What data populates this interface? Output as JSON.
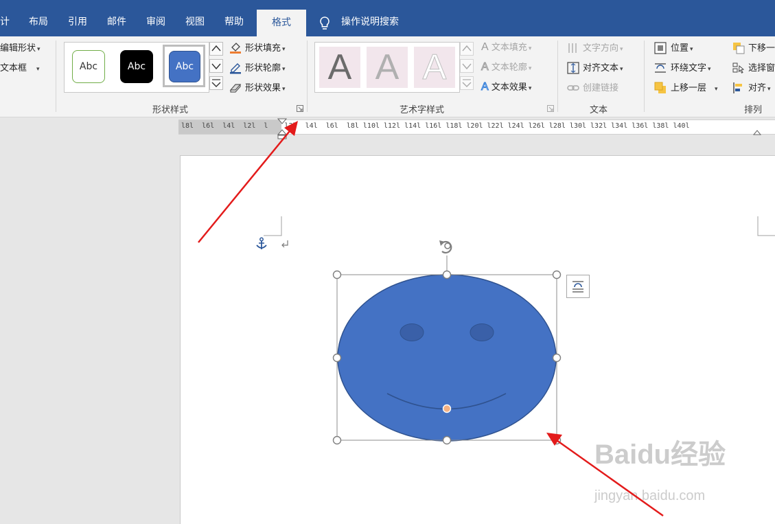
{
  "tabs": {
    "design_partial": "计",
    "layout": "布局",
    "references": "引用",
    "mailings": "邮件",
    "review": "审阅",
    "view": "视图",
    "help": "帮助",
    "format": "格式",
    "tell_me": "操作说明搜索"
  },
  "insert_shapes": {
    "edit_shape": "编辑形状",
    "text_box": "文本框"
  },
  "shape_styles": {
    "swatch_1": "Abc",
    "swatch_2": "Abc",
    "swatch_3": "Abc",
    "fill": "形状填充",
    "outline": "形状轮廓",
    "effects": "形状效果",
    "group_label": "形状样式"
  },
  "wordart": {
    "letter": "A",
    "text_fill": "文本填充",
    "text_outline": "文本轮廓",
    "text_effects": "文本效果",
    "group_label": "艺术字样式"
  },
  "text_group": {
    "direction": "文字方向",
    "align_text": "对齐文本",
    "create_link": "创建链接",
    "group_label": "文本"
  },
  "arrange": {
    "position": "位置",
    "wrap_text": "环绕文字",
    "bring_forward": "上移一层",
    "send_backward": "下移一",
    "selection_pane": "选择窗",
    "align": "对齐",
    "group_label": "排列"
  },
  "ruler": {
    "labels": "l8l  l6l  l4l  l2l  l    l2l  l4l  l6l  l8l l10l l12l l14l l16l l18l l20l l22l l24l l26l l28l l30l l32l l34l l36l l38l l40l"
  },
  "watermark": {
    "brand": "Baidu经验",
    "url": "jingyan.baidu.com"
  },
  "colors": {
    "title_bar": "#2b579a",
    "shape_fill": "#4472c4",
    "shape_stroke": "#2f528f",
    "annotation_arrow": "#e31b1b",
    "adjust_handle": "#f4b183"
  }
}
